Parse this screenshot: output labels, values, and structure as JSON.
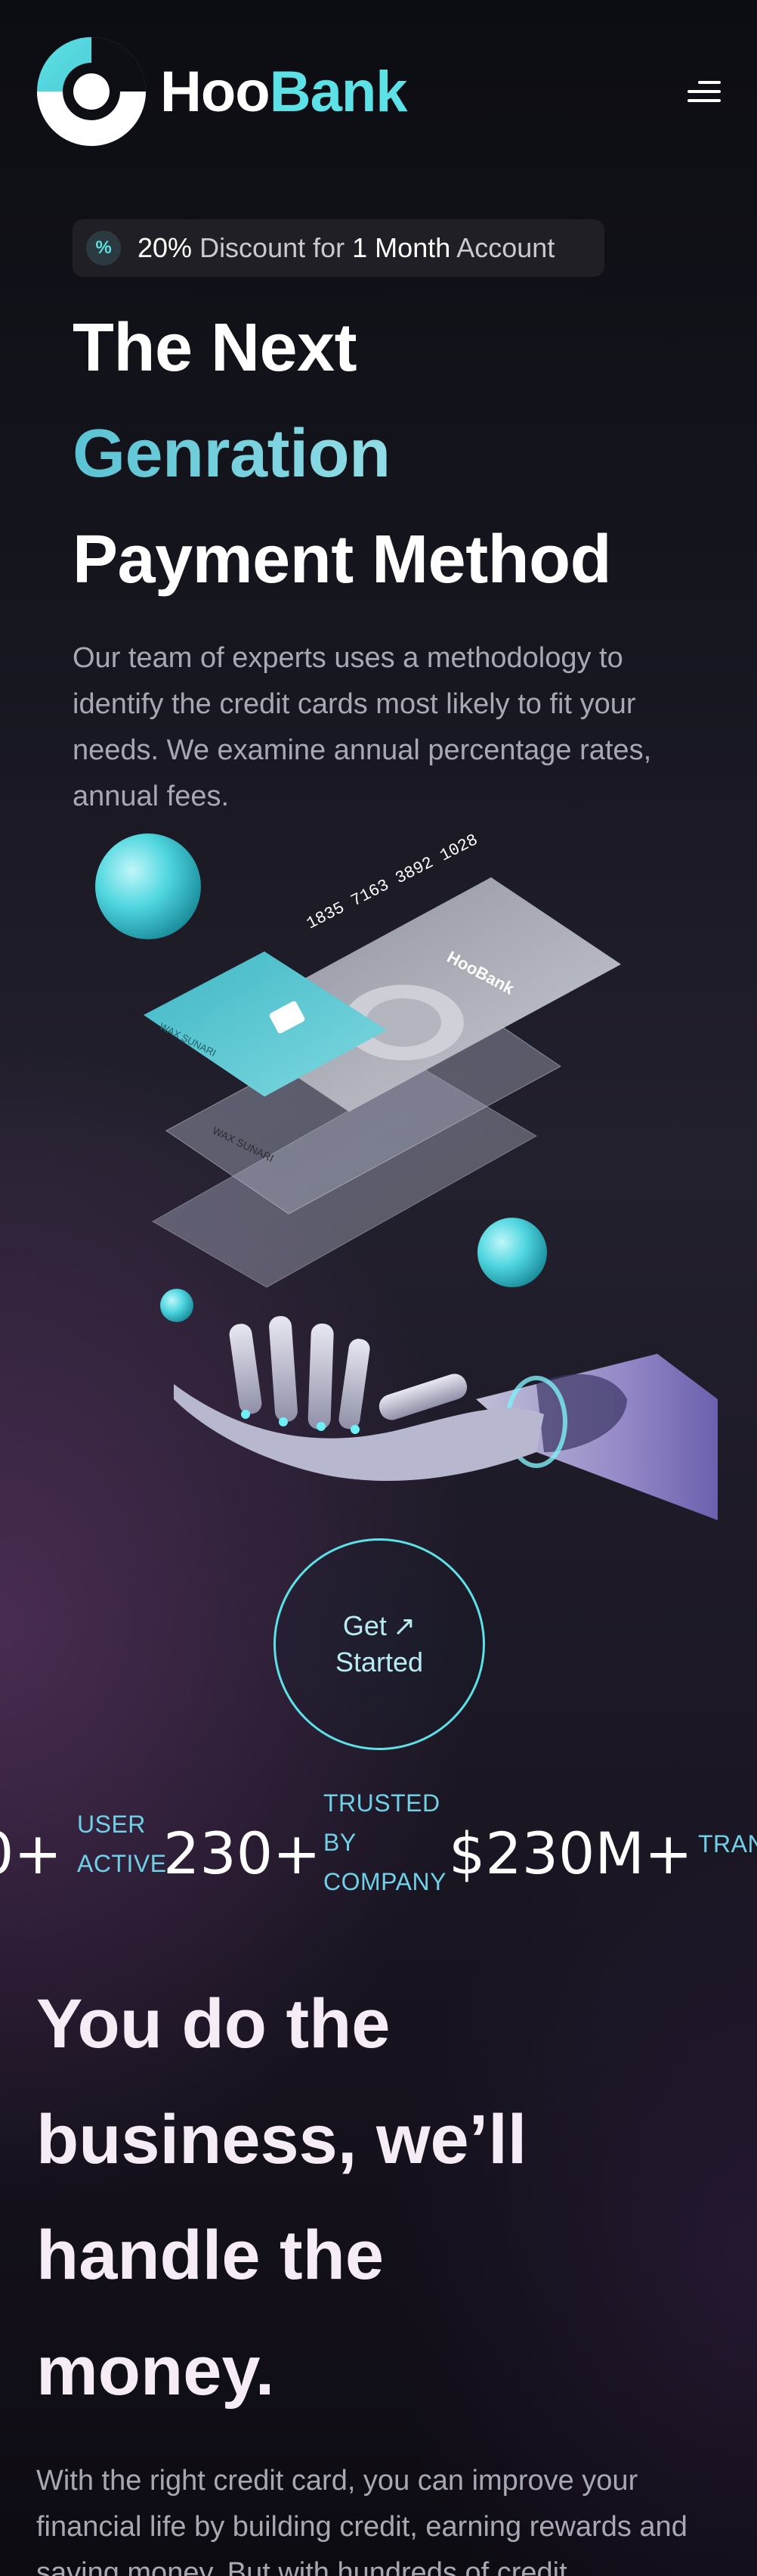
{
  "brand": {
    "name_part1": "Hoo",
    "name_part2": "Bank",
    "accent": "#5ce1e6"
  },
  "nav": {
    "menu_icon": "menu-icon"
  },
  "discount": {
    "icon": "percent-icon",
    "icon_glyph": "%",
    "percent": "20%",
    "mid": " Discount for ",
    "duration": "1 Month",
    "suffix": " Account"
  },
  "hero": {
    "line1": "The Next",
    "line2": "Genration",
    "line3": "Payment Method",
    "description": "Our team of experts uses a methodology to identify the credit cards most likely to fit your needs. We examine annual percentage rates, annual fees."
  },
  "cards": {
    "number": "1835 7163 3892 1028",
    "logo_text": "HooBank",
    "holder": "WAX SUNARI"
  },
  "cta": {
    "line1": "Get",
    "line2": "Started",
    "arrow": "↗"
  },
  "stats": [
    {
      "value": "0+",
      "label_lines": [
        "USER",
        "ACTIVE"
      ]
    },
    {
      "value": "230+",
      "label_lines": [
        "TRUSTED",
        "BY",
        "COMPANY"
      ]
    },
    {
      "value": "$230M+",
      "label_lines": [
        "TRAN"
      ]
    }
  ],
  "business": {
    "title_lines": [
      "You do the",
      "business, we’ll",
      "handle the",
      "money."
    ],
    "description": "With the right credit card, you can improve your financial life by building credit, earning rewards and saving money. But with hundreds of credit"
  }
}
